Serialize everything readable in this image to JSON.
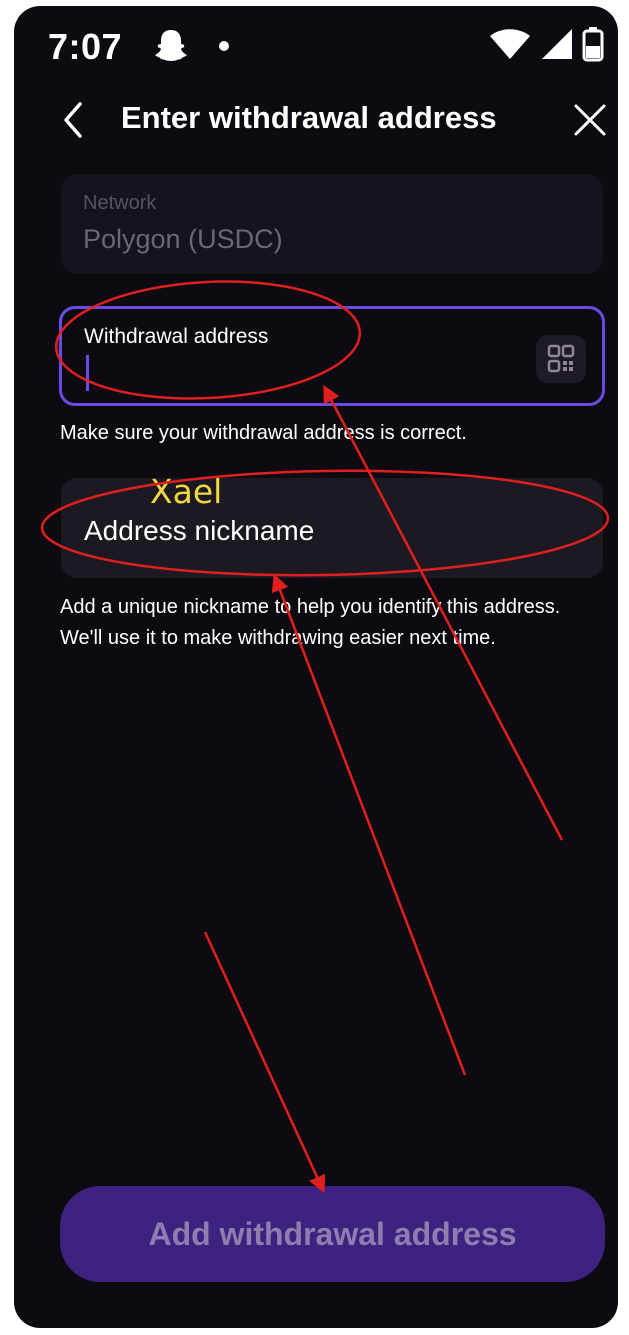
{
  "status_bar": {
    "time": "7:07"
  },
  "header": {
    "title": "Enter withdrawal address"
  },
  "network": {
    "label": "Network",
    "value": "Polygon (USDC)"
  },
  "withdrawal_address": {
    "label": "Withdrawal address",
    "value": "",
    "helper": "Make sure your withdrawal address is correct."
  },
  "nickname": {
    "handwritten_value": "Xael",
    "placeholder": "Address nickname",
    "helper": "Add a unique nickname to help you identify this address. We'll use it to make withdrawing easier next time."
  },
  "submit": {
    "label": "Add withdrawal address"
  },
  "icons": {
    "back": "chevron-left-icon",
    "close": "close-icon",
    "qr": "qr-scan-icon",
    "wifi": "wifi-icon",
    "signal": "signal-icon",
    "battery": "battery-icon",
    "snapchat": "snapchat-ghost-icon"
  },
  "colors": {
    "background": "#0d0a12",
    "accent": "#6c4be3",
    "button": "#3d2280",
    "annotation": "#e0201f",
    "handwriting": "#f0d840"
  }
}
